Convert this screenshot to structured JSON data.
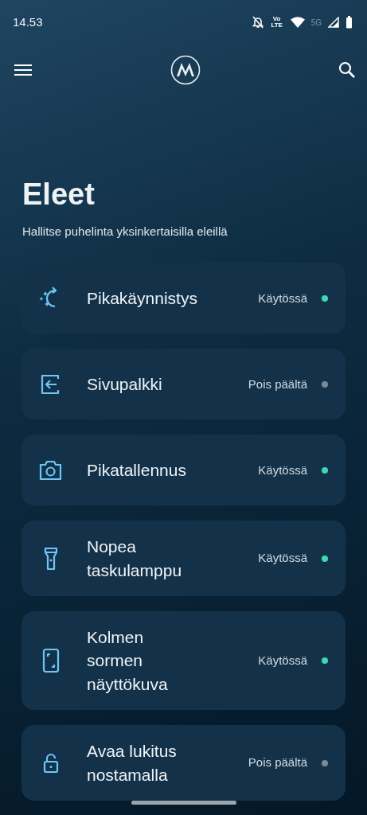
{
  "status_bar": {
    "time": "14.53",
    "volte": "Vo LTE",
    "network": "5G"
  },
  "title": "Eleet",
  "subtitle": "Hallitse puhelinta yksinkertaisilla eleillä",
  "gestures": [
    {
      "title": "Pikakäynnistys",
      "status": "Käytössä",
      "on": true
    },
    {
      "title": "Sivupalkki",
      "status": "Pois päältä",
      "on": false
    },
    {
      "title": "Pikatallennus",
      "status": "Käytössä",
      "on": true
    },
    {
      "title": "Nopea taskulamppu",
      "status": "Käytössä",
      "on": true
    },
    {
      "title": "Kolmen sormen näyttökuva",
      "status": "Käytössä",
      "on": true
    },
    {
      "title": "Avaa lukitus nostamalla",
      "status": "Pois päältä",
      "on": false
    }
  ]
}
